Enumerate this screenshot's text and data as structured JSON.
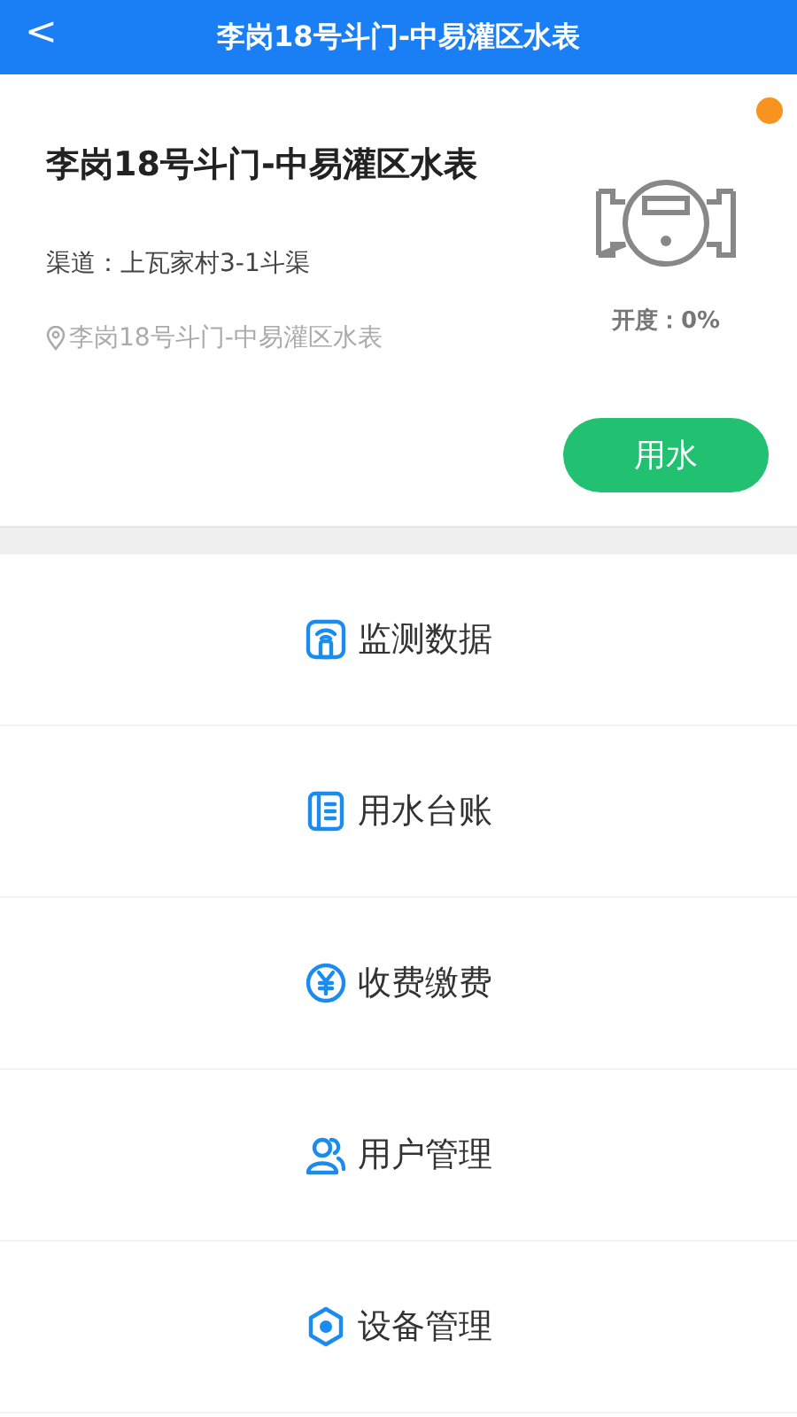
{
  "header": {
    "back": "<",
    "title": "李岗18号斗门-中易灌区水表"
  },
  "device": {
    "name": "李岗18号斗门-中易灌区水表",
    "channel": "渠道：上瓦家村3-1斗渠",
    "location": "李岗18号斗门-中易灌区水表",
    "opening": "开度：0%",
    "indicator": {
      "color": "#f7931e"
    },
    "action": "用水"
  },
  "menu": [
    {
      "kind": "monitor",
      "label": "监测数据"
    },
    {
      "kind": "ledger",
      "label": "用水台账"
    },
    {
      "kind": "fee",
      "label": "收费缴费"
    },
    {
      "kind": "users",
      "label": "用户管理"
    },
    {
      "kind": "device",
      "label": "设备管理"
    }
  ]
}
